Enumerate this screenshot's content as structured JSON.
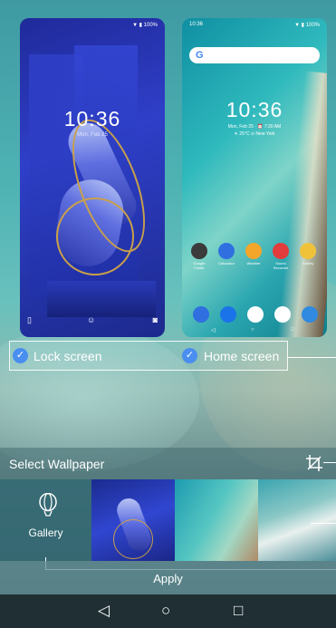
{
  "lock_preview": {
    "status_text": "▼ ▮ 100%",
    "time": "10:36",
    "date": "Mon, Feb 25"
  },
  "home_preview": {
    "status_time": "10:36",
    "status_text": "▼ ▮ 100%",
    "search_logo": "G",
    "time": "10:36",
    "date": "Mon, Feb 25 · ⏰ 7:30 AM",
    "weather": "☀ 25°C  ⊙ New York",
    "apps": [
      {
        "label": "Google\nFolder",
        "color": "#3b3b3b"
      },
      {
        "label": "Calculator",
        "color": "#2f6fe0"
      },
      {
        "label": "Weather",
        "color": "#f4a62a"
      },
      {
        "label": "Sound\nRecorder",
        "color": "#e23c3c"
      },
      {
        "label": "Gallery",
        "color": "#f0c23a"
      }
    ],
    "dock_colors": [
      "#2f6fe0",
      "#1a73e8",
      "#ffffff",
      "#ffffff",
      "#2f8ae0"
    ]
  },
  "selection": {
    "lock_label": "Lock screen",
    "home_label": "Home screen",
    "check_color": "#4a8ef0"
  },
  "wallpaper_bar": {
    "title": "Select Wallpaper"
  },
  "gallery": {
    "label": "Gallery"
  },
  "apply": {
    "label": "Apply"
  },
  "nav": {
    "back": "◁",
    "home": "○",
    "recents": "□"
  }
}
